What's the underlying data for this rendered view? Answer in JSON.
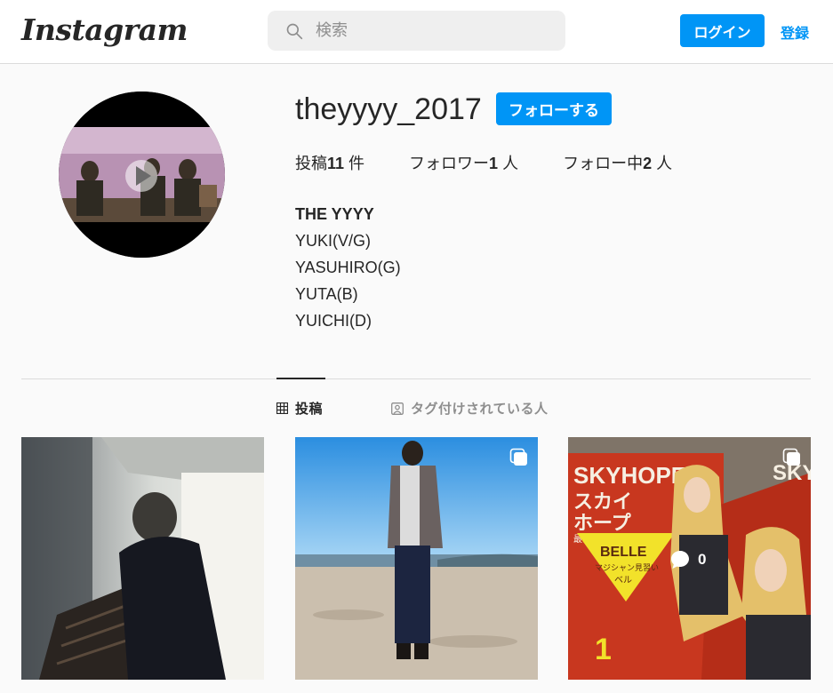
{
  "header": {
    "logo_text": "Instagram",
    "search_placeholder": "検索",
    "login_label": "ログイン",
    "signup_label": "登録"
  },
  "profile": {
    "username": "theyyyy_2017",
    "follow_label": "フォローする",
    "stats": {
      "posts_prefix": "投稿",
      "posts_count": "11",
      "posts_suffix": " 件",
      "followers_prefix": "フォロワー",
      "followers_count": "1",
      "followers_suffix": " 人",
      "following_prefix": "フォロー中",
      "following_count": "2",
      "following_suffix": " 人"
    },
    "bio": {
      "name": "THE YYYY",
      "lines": [
        "YUKI(V/G)",
        "YASUHIRO(G)",
        "YUTA(B)",
        "YUICHI(D)"
      ]
    }
  },
  "tabs": {
    "posts_label": "投稿",
    "tagged_label": "タグ付けされている人"
  },
  "grid": {
    "tile3": {
      "comment_count": "0",
      "cover_text_main": "SKYHOPE",
      "cover_text_kana1": "スカイ",
      "cover_text_kana2": "ホープ",
      "cover_text_sub": "最後の飛行",
      "cover_text_belle": "BELLE",
      "cover_text_belle_sub1": "マジシャン見習い",
      "cover_text_belle_sub2": "ベル",
      "cover_text_vol": "1",
      "cover_text_right": "SKY"
    }
  },
  "colors": {
    "accent": "#0095f6",
    "text": "#262626",
    "muted": "#8e8e8e",
    "border": "#dbdbdb",
    "background": "#fafafa"
  }
}
